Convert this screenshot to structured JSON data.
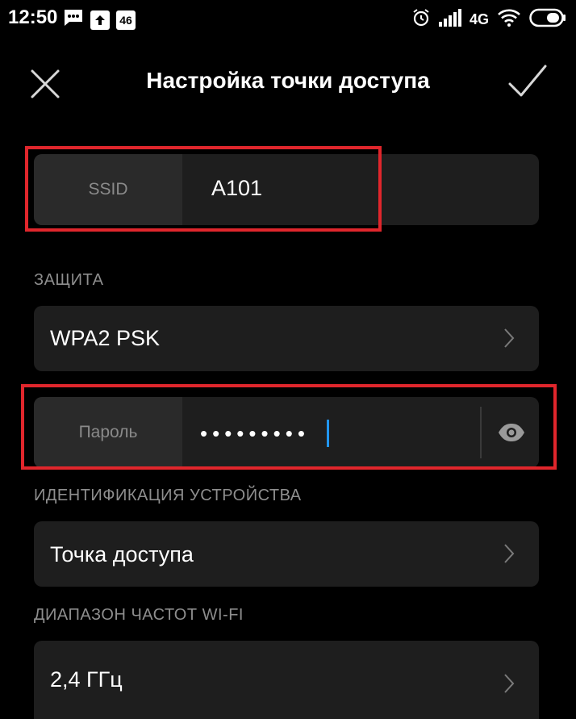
{
  "status_bar": {
    "time": "12:50",
    "badge_46": "46",
    "network": "4G",
    "icons": [
      "message-icon",
      "upload-icon",
      "alarm-icon",
      "signal-icon",
      "wifi-icon",
      "battery-icon"
    ]
  },
  "header": {
    "title": "Настройка точки доступа",
    "close_icon": "close-icon",
    "confirm_icon": "check-icon"
  },
  "ssid": {
    "label": "SSID",
    "value": "A101"
  },
  "security": {
    "section_label": "ЗАЩИТА",
    "value": "WPA2 PSK"
  },
  "password": {
    "label": "Пароль",
    "value": "•••••••••"
  },
  "device_id": {
    "section_label": "ИДЕНТИФИКАЦИЯ УСТРОЙСТВА",
    "value": "Точка доступа"
  },
  "band": {
    "section_label": "ДИАПАЗОН ЧАСТОТ WI-FI",
    "value": "2,4 ГГц"
  },
  "colors": {
    "background": "#000000",
    "card": "#1e1e1e",
    "highlight": "#e0262c",
    "caret": "#2196f3"
  }
}
